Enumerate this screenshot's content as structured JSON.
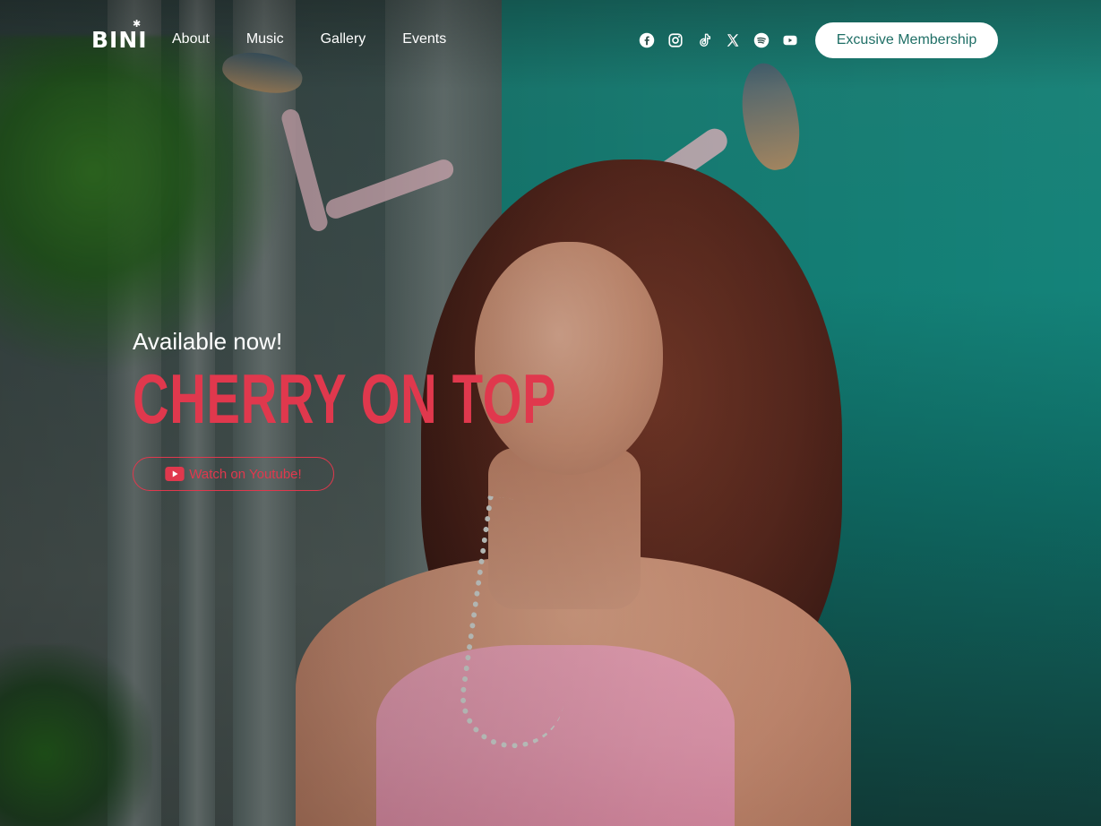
{
  "brand": {
    "logo_text": "BINI",
    "logo_star": "✱"
  },
  "nav": {
    "links": [
      {
        "label": "About"
      },
      {
        "label": "Music"
      },
      {
        "label": "Gallery"
      },
      {
        "label": "Events"
      }
    ]
  },
  "socials": [
    {
      "icon": "facebook-icon"
    },
    {
      "icon": "instagram-icon"
    },
    {
      "icon": "tiktok-icon"
    },
    {
      "icon": "x-twitter-icon"
    },
    {
      "icon": "spotify-icon"
    },
    {
      "icon": "youtube-icon"
    }
  ],
  "membership_button": {
    "label": "Excusive Membership"
  },
  "hero": {
    "kicker": "Available now!",
    "title": "CHERRY ON TOP",
    "cta_label": "Watch on Youtube!",
    "cta_icon": "youtube-icon"
  },
  "colors": {
    "accent": "#e0384d",
    "membership_text": "#1f6f66",
    "nav_text": "#ffffff"
  }
}
